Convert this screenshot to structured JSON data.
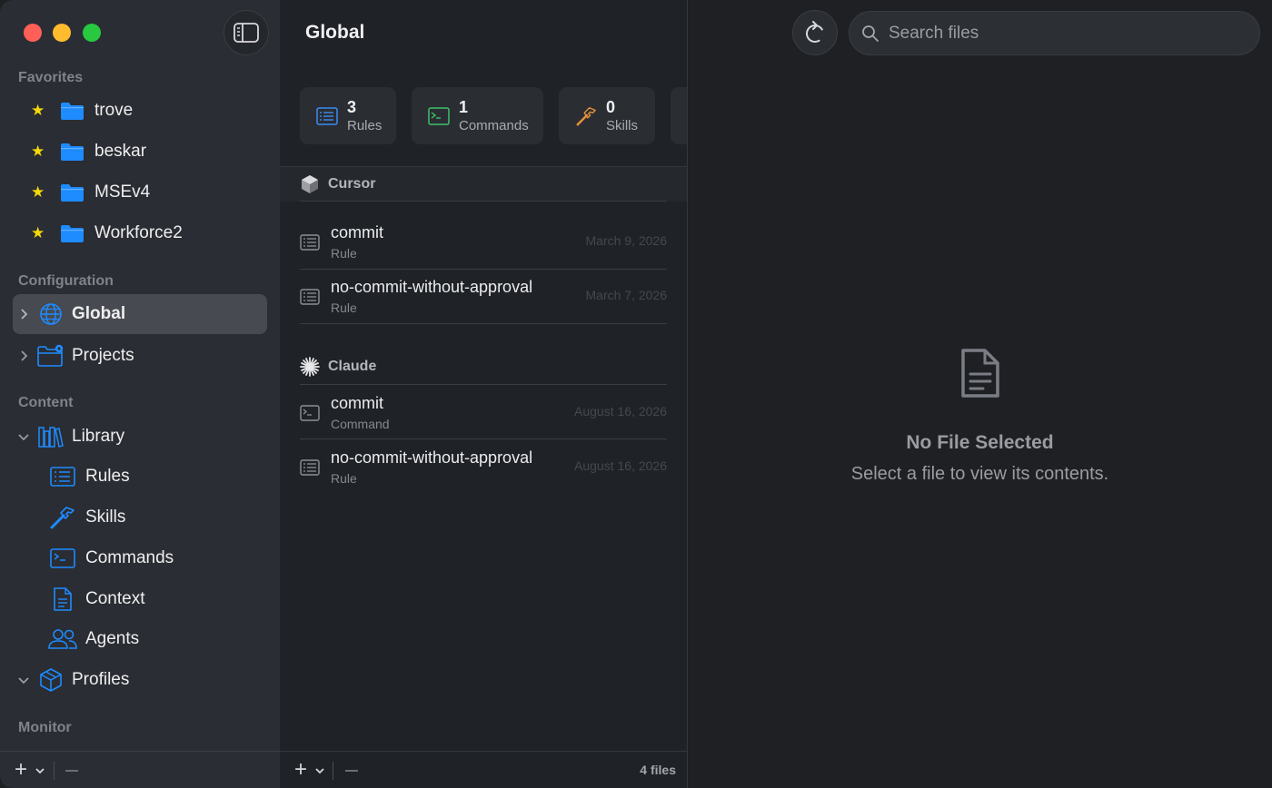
{
  "sidebar": {
    "favorites_title": "Favorites",
    "favorites": [
      {
        "label": "trove"
      },
      {
        "label": "beskar"
      },
      {
        "label": "MSEv4"
      },
      {
        "label": "Workforce2"
      }
    ],
    "configuration_title": "Configuration",
    "configuration": [
      {
        "label": "Global",
        "icon": "globe-icon",
        "selected": true
      },
      {
        "label": "Projects",
        "icon": "folder-gear-icon"
      }
    ],
    "content_title": "Content",
    "library_label": "Library",
    "library_items": [
      {
        "label": "Rules",
        "icon": "list-icon"
      },
      {
        "label": "Skills",
        "icon": "hammer-icon"
      },
      {
        "label": "Commands",
        "icon": "terminal-icon"
      },
      {
        "label": "Context",
        "icon": "document-icon"
      },
      {
        "label": "Agents",
        "icon": "people-icon"
      }
    ],
    "profiles_label": "Profiles",
    "monitor_title": "Monitor"
  },
  "middle": {
    "title": "Global",
    "stats": [
      {
        "count": "3",
        "label": "Rules",
        "icon": "list-icon",
        "color": "#3b8cf5"
      },
      {
        "count": "1",
        "label": "Commands",
        "icon": "terminal-icon",
        "color": "#3cc26a"
      },
      {
        "count": "0",
        "label": "Skills",
        "icon": "hammer-icon",
        "color": "#e8923a"
      }
    ],
    "groups": [
      {
        "name": "Cursor",
        "files": [
          {
            "name": "commit",
            "type": "Rule",
            "date": "March 9, 2026"
          },
          {
            "name": "no-commit-without-approval",
            "type": "Rule",
            "date": "March 7, 2026"
          }
        ]
      },
      {
        "name": "Claude",
        "files": [
          {
            "name": "commit",
            "type": "Command",
            "date": "August 16, 2026"
          },
          {
            "name": "no-commit-without-approval",
            "type": "Rule",
            "date": "August 16, 2026"
          }
        ]
      }
    ],
    "file_count": "4 files"
  },
  "detail": {
    "search_placeholder": "Search files",
    "empty_title": "No File Selected",
    "empty_subtitle": "Select a file to view its contents."
  },
  "colors": {
    "accent": "#1e8bff",
    "star": "#f5d90a"
  }
}
